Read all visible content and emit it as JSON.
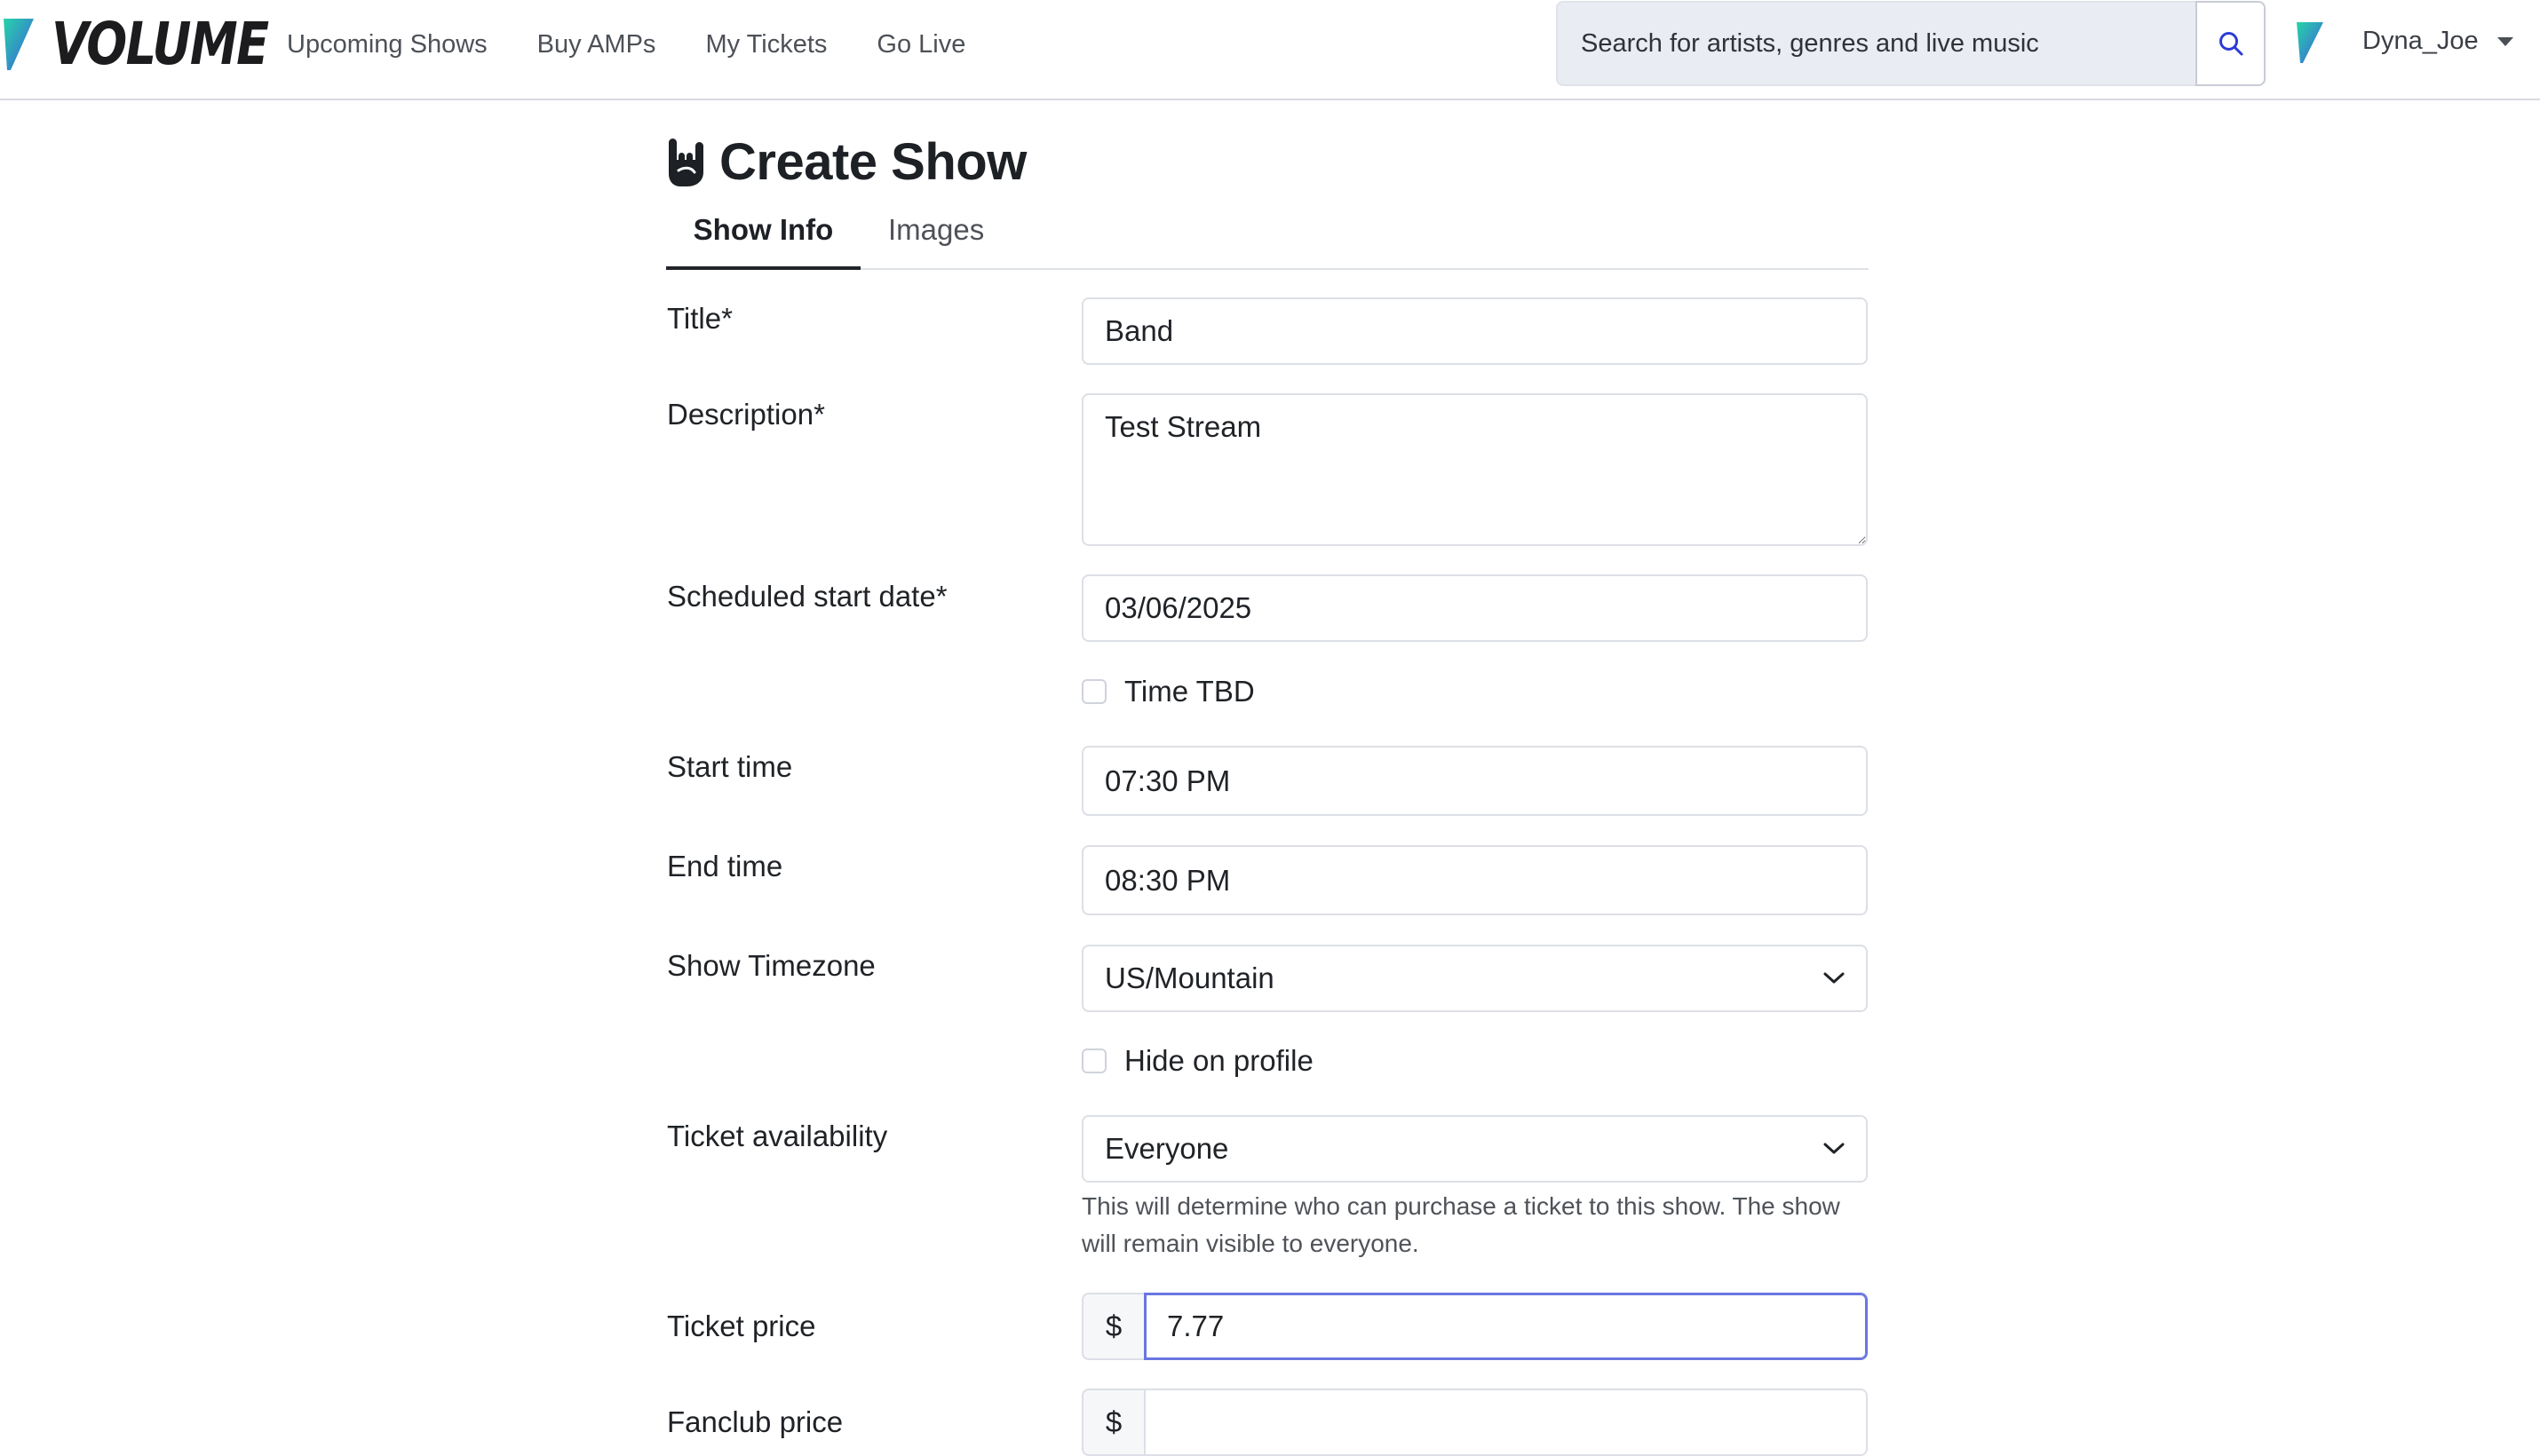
{
  "navbar": {
    "brand": "VOLUME",
    "links": [
      "Upcoming Shows",
      "Buy AMPs",
      "My Tickets",
      "Go Live"
    ],
    "search_placeholder": "Search for artists, genres and live music",
    "username": "Dyna_Joe",
    "icons": {
      "search": "search-icon",
      "user_menu": "caret-down-icon"
    },
    "colors": {
      "accent": "#6a76e0",
      "brand_gradient_start": "#3c5bdc",
      "brand_gradient_end": "#27d4a8"
    }
  },
  "page": {
    "title": "Create Show",
    "title_icon": "rock-hand-icon",
    "tabs": [
      {
        "label": "Show Info",
        "active": true
      },
      {
        "label": "Images",
        "active": false
      }
    ]
  },
  "form": {
    "title_label": "Title*",
    "title_value": "Band",
    "description_label": "Description*",
    "description_value": "Test Stream",
    "start_date_label": "Scheduled start date*",
    "start_date_value": "03/06/2025",
    "time_tbd_label": "Time TBD",
    "start_time_label": "Start time",
    "start_time_value": "07:30 PM",
    "end_time_label": "End time",
    "end_time_value": "08:30 PM",
    "timezone_label": "Show Timezone",
    "timezone_value": "US/Mountain",
    "hide_profile_label": "Hide on profile",
    "availability_label": "Ticket availability",
    "availability_value": "Everyone",
    "availability_help": "This will determine who can purchase a ticket to this show. The show will remain visible to everyone.",
    "ticket_price_label": "Ticket price",
    "currency_symbol": "$",
    "ticket_price_value": "7.77",
    "fanclub_price_label": "Fanclub price",
    "fanclub_price_value": ""
  }
}
